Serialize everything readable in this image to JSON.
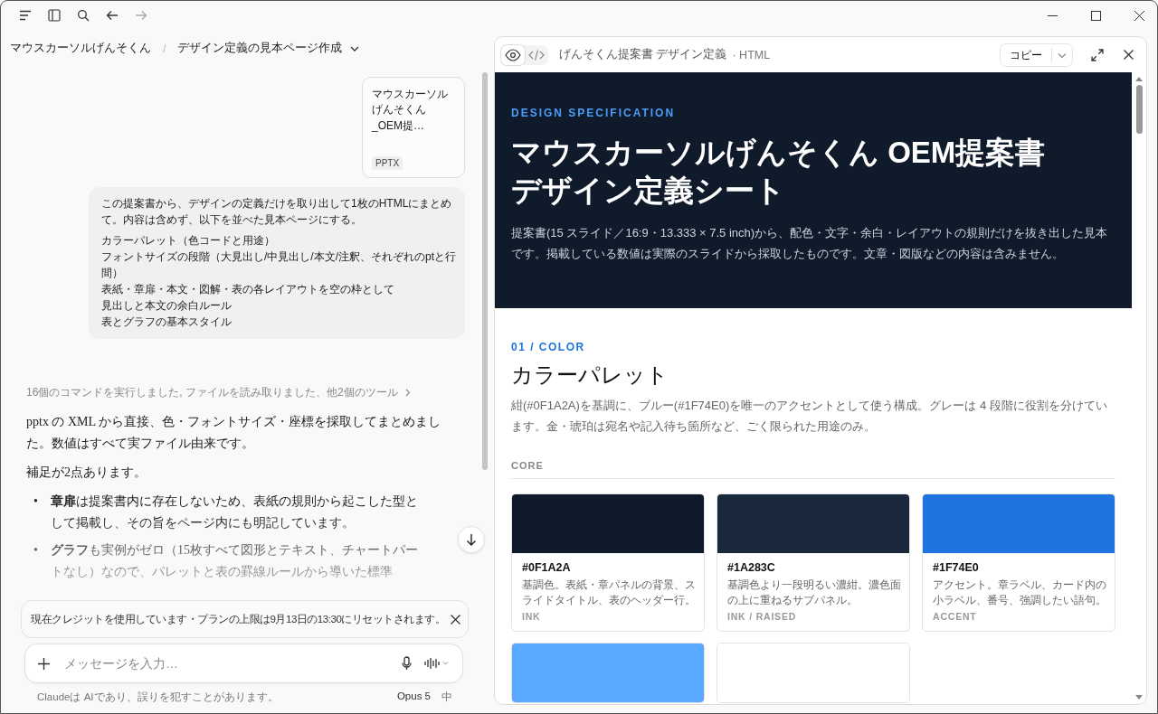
{
  "breadcrumb": {
    "project": "マウスカーソルげんそくん",
    "separator": "/",
    "chat": "デザイン定義の見本ページ作成"
  },
  "attachment": {
    "name": "マウスカーソルげんそくん_OEM提…",
    "type": "PPTX"
  },
  "user_message": {
    "intro": "この提案書から、デザインの定義だけを取り出して1枚のHTMLにまとめて。内容は含めず、以下を並べた見本ページにする。",
    "lines": [
      "カラーパレット（色コードと用途）",
      "フォントサイズの段階（大見出し/中見出し/本文/注釈、それぞれのptと行間）",
      "表紙・章扉・本文・図解・表の各レイアウトを空の枠として",
      "見出しと本文の余白ルール",
      "表とグラフの基本スタイル"
    ]
  },
  "tool_summary": "16個のコマンドを実行しました, ファイルを読み取りました、他2個のツール",
  "assistant": {
    "marker": "•",
    "paragraphs": [
      "pptx の XML から直接、色・フォントサイズ・座標を採取してまとめました。数値はすべて実ファイル由来です。",
      "補足が2点あります。"
    ],
    "bullets": [
      "**章扉**は提案書内に存在しないため、表紙の規則から起こした型として掲載し、その旨をページ内にも明記しています。",
      "**グラフ**も実例がゼロ（15枚すべて図形とテキスト、チャートパートなし）なので、パレットと表の罫線ルールから導いた標準"
    ]
  },
  "notice": "現在クレジットを使用しています・プランの上限は9月13日の13:30にリセットされます。",
  "composer": {
    "placeholder": "メッセージを入力…"
  },
  "footer": {
    "disclaimer": "Claudeは AIであり、誤りを犯すことがあります。",
    "model": "Opus 5",
    "effort": "中"
  },
  "artifact": {
    "view_toggle": [
      {
        "kind": "preview",
        "selected": true
      },
      {
        "kind": "code",
        "selected": false
      }
    ],
    "title": "げんそくん提案書 デザイン定義",
    "type": "· HTML",
    "copy": "コピー",
    "hero": {
      "eyebrow": "DESIGN SPECIFICATION",
      "title_lines": [
        "マウスカーソルげんそくん OEM提案書",
        "デザイン定義シート"
      ],
      "lead": "提案書(15 スライド／16:9・13.333 × 7.5 inch)から、配色・文字・余白・レイアウトの規則だけを抜き出した見本です。掲載している数値は実際のスライドから採取したものです。文章・図版などの内容は含みません。"
    },
    "section": {
      "eyebrow": "01 / COLOR",
      "title": "カラーパレット",
      "lead": "紺(#0F1A2A)を基調に、ブルー(#1F74E0)を唯一のアクセントとして使う構成。グレーは 4 段階に役割を分けています。金・琥珀は宛名や記入待ち箇所など、ごく限られた用途のみ。",
      "group": "CORE"
    },
    "swatches": [
      {
        "color": "#0f1a2a",
        "hex": "#0F1A2A",
        "usage": "基調色。表紙・章パネルの背景、スライドタイトル、表のヘッダー行。",
        "role": "INK"
      },
      {
        "color": "#1a283c",
        "hex": "#1A283C",
        "usage": "基調色より一段明るい濃紺。濃色面の上に重ねるサブパネル。",
        "role": "INK / RAISED"
      },
      {
        "color": "#1f74e0",
        "hex": "#1F74E0",
        "usage": "アクセント。章ラベル、カード内の小ラベル、番号、強調したい語句。",
        "role": "ACCENT"
      },
      {
        "color": "#5aa8ff"
      },
      {
        "color": "#ffffff"
      }
    ]
  }
}
